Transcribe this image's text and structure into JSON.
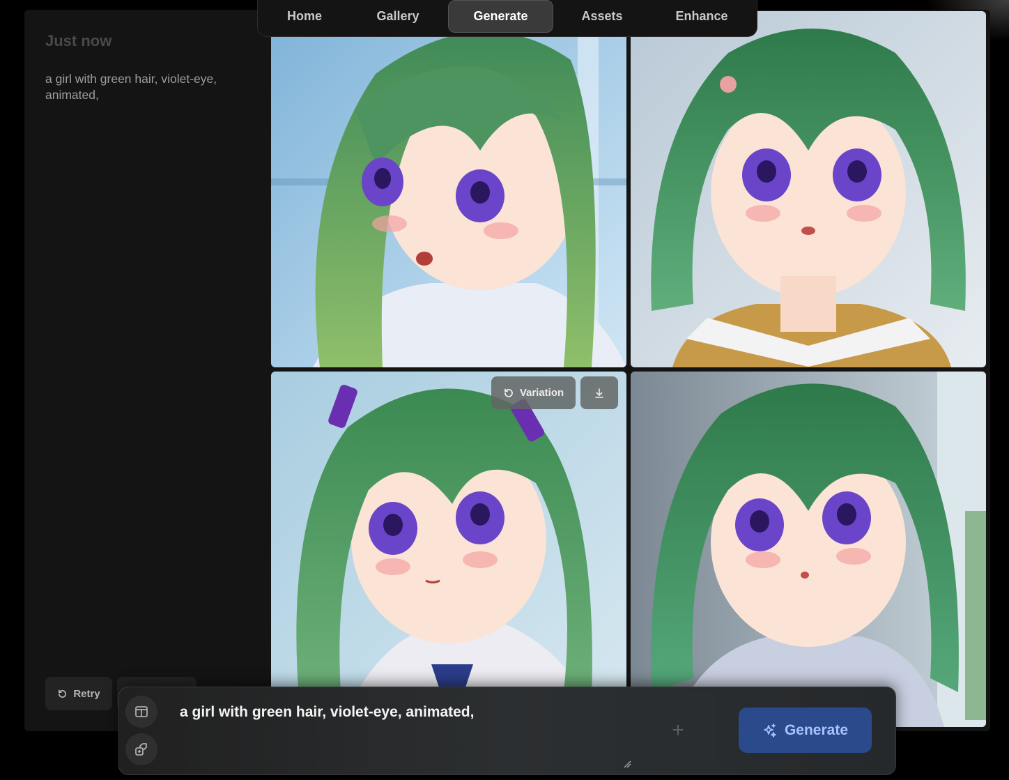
{
  "nav": {
    "items": [
      {
        "label": "Home"
      },
      {
        "label": "Gallery"
      },
      {
        "label": "Generate",
        "active": true
      },
      {
        "label": "Assets"
      },
      {
        "label": "Enhance"
      }
    ]
  },
  "history": {
    "time": "Just now",
    "prompt": "a girl with green hair, violet-eye, animated,",
    "retry_label": "Retry"
  },
  "results": {
    "images": [
      {
        "alt": "anime girl with long green hair and violet eyes, mouth open"
      },
      {
        "alt": "anime girl with short green hair in sailor uniform"
      },
      {
        "alt": "anime girl with green twin-tails and violet eyes"
      },
      {
        "alt": "anime girl with green bob hair and violet eyes"
      }
    ],
    "variation_label": "Variation"
  },
  "composer": {
    "prompt": "a girl with green hair, violet-eye, animated,",
    "add_symbol": "+",
    "generate_label": "Generate"
  },
  "colors": {
    "accent": "#2b4a8c",
    "accent_text": "#a9c3ff",
    "hair": "#3d8a55",
    "eyes": "#7a5ad6"
  }
}
